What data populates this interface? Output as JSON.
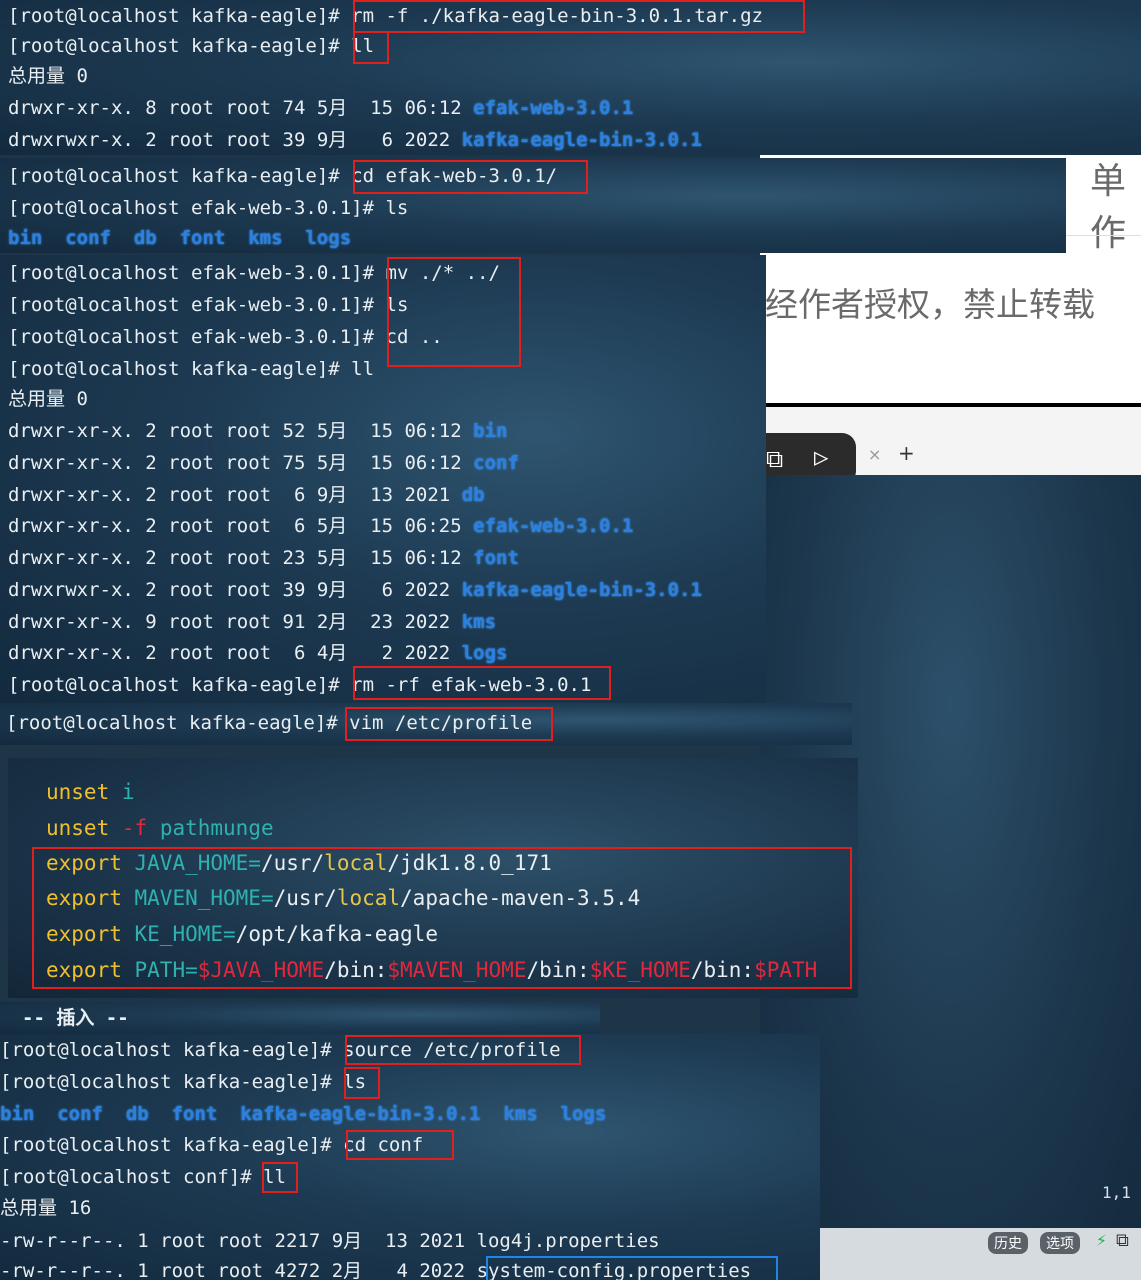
{
  "bg_right": {
    "title_fragment": "单作",
    "notice": "经作者授权，禁止转载",
    "tab_close": "×",
    "tab_add": "+",
    "cursor_pos": "1,1",
    "btn_history": "历史",
    "btn_options": "选项"
  },
  "panel1": {
    "l1_prompt": "[root@localhost kafka-eagle]# ",
    "l1_cmd": "rm -f ./kafka-eagle-bin-3.0.1.tar.gz",
    "l2_prompt": "[root@localhost kafka-eagle]# ",
    "l2_cmd": "ll",
    "l3": "总用量 0",
    "l4_meta": "drwxr-xr-x. 8 root root 74 5月  15 06:12 ",
    "l4_name": "efak-web-3.0.1",
    "l5_meta": "drwxrwxr-x. 2 root root 39 9月   6 2022 ",
    "l5_name": "kafka-eagle-bin-3.0.1"
  },
  "panel2": {
    "l1_prompt": "[root@localhost kafka-eagle]# ",
    "l1_cmd": "cd efak-web-3.0.1/",
    "l2": "[root@localhost efak-web-3.0.1]# ls",
    "dirs": "bin  conf  db  font  kms  logs"
  },
  "panel3": {
    "l1_prompt": "[root@localhost efak-web-3.0.1]# ",
    "l1_cmd": "mv ./* ../",
    "l2_prompt": "[root@localhost efak-web-3.0.1]# ",
    "l2_cmd": "ls",
    "l3_prompt": "[root@localhost efak-web-3.0.1]# ",
    "l3_cmd": "cd ..",
    "l4": "[root@localhost kafka-eagle]# ll",
    "l5": "总用量 0",
    "rows": [
      {
        "meta": "drwxr-xr-x. 2 root root 52 5月  15 06:12 ",
        "name": "bin"
      },
      {
        "meta": "drwxr-xr-x. 2 root root 75 5月  15 06:12 ",
        "name": "conf"
      },
      {
        "meta": "drwxr-xr-x. 2 root root  6 9月  13 2021 ",
        "name": "db"
      },
      {
        "meta": "drwxr-xr-x. 2 root root  6 5月  15 06:25 ",
        "name": "efak-web-3.0.1"
      },
      {
        "meta": "drwxr-xr-x. 2 root root 23 5月  15 06:12 ",
        "name": "font"
      },
      {
        "meta": "drwxrwxr-x. 2 root root 39 9月   6 2022 ",
        "name": "kafka-eagle-bin-3.0.1"
      },
      {
        "meta": "drwxr-xr-x. 9 root root 91 2月  23 2022 ",
        "name": "kms"
      },
      {
        "meta": "drwxr-xr-x. 2 root root  6 4月   2 2022 ",
        "name": "logs"
      }
    ],
    "last_prompt": "[root@localhost kafka-eagle]# ",
    "last_cmd": "rm -rf efak-web-3.0.1"
  },
  "panel4": {
    "prompt": "[root@localhost kafka-eagle]# ",
    "cmd": "vim /etc/profile"
  },
  "vim": {
    "l1_kw": "unset",
    "l1_arg": "i",
    "l2_kw": "unset",
    "l2_flag": "-f",
    "l2_arg": "pathmunge",
    "e1_kw": "export",
    "e1_var": "JAVA_HOME=",
    "e1_a": "/usr/",
    "e1_b": "local",
    "e1_c": "/jdk1.8.0_171",
    "e2_kw": "export",
    "e2_var": "MAVEN_HOME=",
    "e2_a": "/usr/",
    "e2_b": "local",
    "e2_c": "/apache-maven-3.5.4",
    "e3_kw": "export",
    "e3_var": "KE_HOME=",
    "e3_a": "/opt/kafka-eagle",
    "e4_kw": "export",
    "e4_var": "PATH=",
    "e4_r1": "$JAVA_HOME",
    "e4_s1": "/bin:",
    "e4_r2": "$MAVEN_HOME",
    "e4_s2": "/bin:",
    "e4_r3": "$KE_HOME",
    "e4_s3": "/bin:",
    "e4_r4": "$PATH",
    "mode": "-- 插入 --"
  },
  "panel5": {
    "l1_prompt": "[root@localhost kafka-eagle]# ",
    "l1_cmd": "source /etc/profile",
    "l2_prompt": "[root@localhost kafka-eagle]# ",
    "l2_cmd": "ls",
    "dirs": "bin  conf  db  font  kafka-eagle-bin-3.0.1  kms  logs",
    "l3_prompt": "[root@localhost kafka-eagle]# ",
    "l3_cmd": "cd conf",
    "l4_prompt": "[root@localhost conf]# ",
    "l4_cmd": "ll",
    "l5": "总用量 16",
    "f1": "-rw-r--r--. 1 root root 2217 9月  13 2021 log4j.properties",
    "f2_meta": "-rw-r--r--. 1 root root 4272 2月   4 2022 ",
    "f2_name": "system-config.properties"
  },
  "colors": {
    "highlight_red": "#e0201c",
    "highlight_blue": "#1e86e6",
    "dir_blue": "#2d7fe0",
    "keyword_yellow": "#f0c02c",
    "var_teal": "#2fb1b0",
    "ref_red": "#e2283c"
  }
}
